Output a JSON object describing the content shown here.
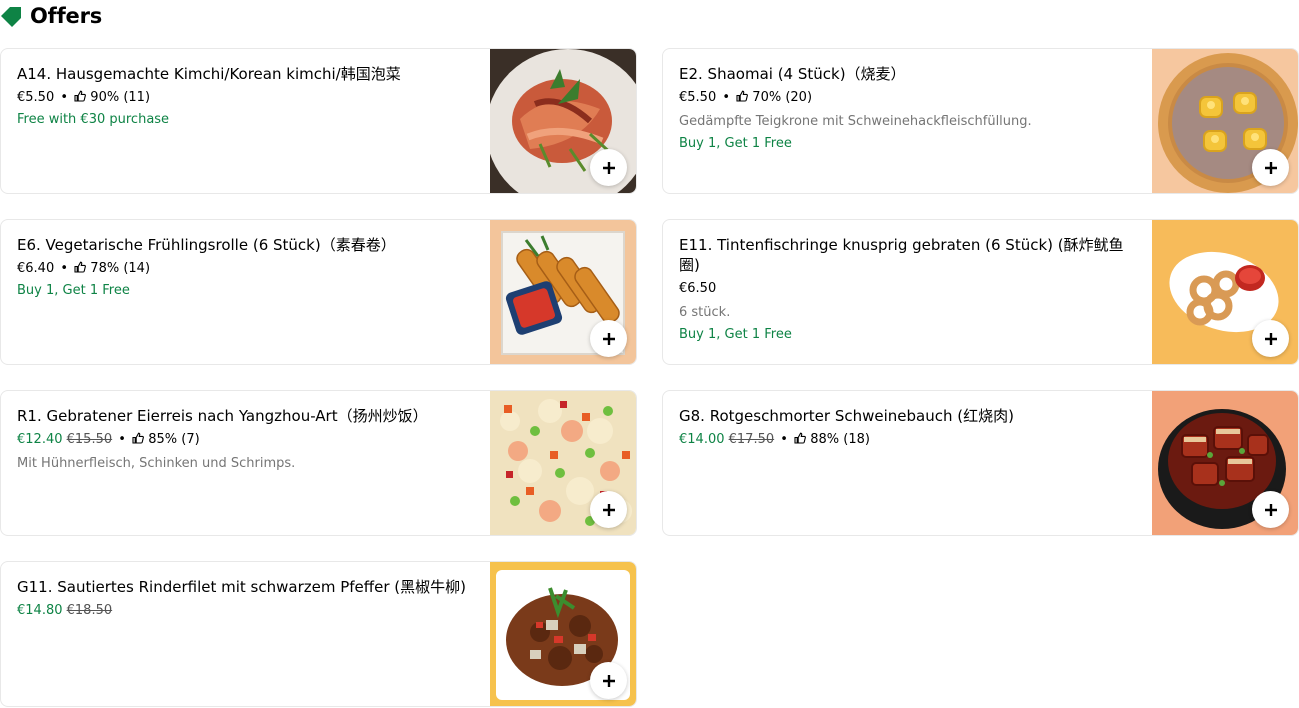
{
  "section": {
    "title": "Offers",
    "icon": "tag-icon"
  },
  "colors": {
    "accent_green": "#0e8345",
    "tag_green": "#0e8345"
  },
  "items": [
    {
      "title": "A14. Hausgemachte Kimchi/Korean kimchi/韩国泡菜",
      "price": "€5.50",
      "rating": "90% (11)",
      "promo": "Free with €30 purchase",
      "image_icon": "kimchi-image"
    },
    {
      "title": "E2. Shaomai (4 Stück)（烧麦）",
      "price": "€5.50",
      "rating": "70% (20)",
      "description": "Gedämpfte Teigkrone mit Schweinehackfleischfüllung.",
      "promo": "Buy 1, Get 1 Free",
      "image_icon": "shaomai-image"
    },
    {
      "title": "E6. Vegetarische Frühlingsrolle (6 Stück)（素春卷）",
      "price": "€6.40",
      "rating": "78% (14)",
      "promo": "Buy 1, Get 1 Free",
      "image_icon": "spring-roll-image"
    },
    {
      "title": "E11. Tintenfischringe knusprig gebraten (6 Stück) (酥炸鱿鱼圈)",
      "price": "€6.50",
      "description": "6 stück.",
      "promo": "Buy 1, Get 1 Free",
      "image_icon": "squid-rings-image"
    },
    {
      "title": "R1. Gebratener Eierreis nach Yangzhou-Art（扬州炒饭）",
      "sale_price": "€12.40",
      "old_price": "€15.50",
      "rating": "85% (7)",
      "description": "Mit Hühnerfleisch, Schinken und Schrimps.",
      "image_icon": "fried-rice-image"
    },
    {
      "title": "G8. Rotgeschmorter Schweinebauch (红烧肉)",
      "sale_price": "€14.00",
      "old_price": "€17.50",
      "rating": "88% (18)",
      "image_icon": "pork-belly-image"
    },
    {
      "title": "G11. Sautiertes Rinderfilet mit schwarzem Pfeffer (黑椒牛柳)",
      "sale_price": "€14.80",
      "old_price": "€18.50",
      "image_icon": "beef-pepper-image"
    }
  ],
  "add_button": {
    "icon": "plus-icon"
  }
}
